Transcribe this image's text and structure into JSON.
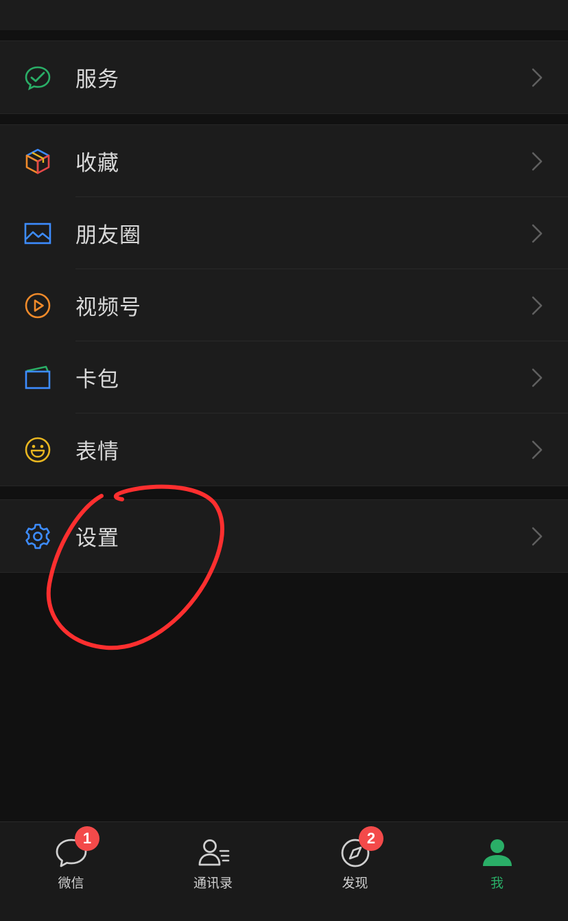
{
  "menu": {
    "services": {
      "label": "服务",
      "icon": "service-check-bubble-icon",
      "color": "#2aae67"
    },
    "items": [
      {
        "label": "收藏",
        "icon": "favorites-cube-icon"
      },
      {
        "label": "朋友圈",
        "icon": "moments-picture-icon",
        "color": "#3d8cff"
      },
      {
        "label": "视频号",
        "icon": "channels-play-icon",
        "color": "#f08a2a"
      },
      {
        "label": "卡包",
        "icon": "card-wallet-icon",
        "color": "#3d8cff"
      },
      {
        "label": "表情",
        "icon": "sticker-smiley-icon",
        "color": "#e8b620"
      }
    ],
    "settings": {
      "label": "设置",
      "icon": "gear-icon",
      "color": "#3d8cff"
    }
  },
  "annotation": {
    "color": "#ff2f2f"
  },
  "tabbar": {
    "tabs": [
      {
        "label": "微信",
        "badge": "1",
        "icon": "chat-bubble-icon"
      },
      {
        "label": "通讯录",
        "icon": "contacts-icon"
      },
      {
        "label": "发现",
        "badge": "2",
        "icon": "compass-icon"
      },
      {
        "label": "我",
        "icon": "me-person-icon",
        "active_color": "#2aae67"
      }
    ]
  },
  "colors": {
    "background": "#111111",
    "panel": "#1c1c1c",
    "badge": "#f34a4a"
  }
}
